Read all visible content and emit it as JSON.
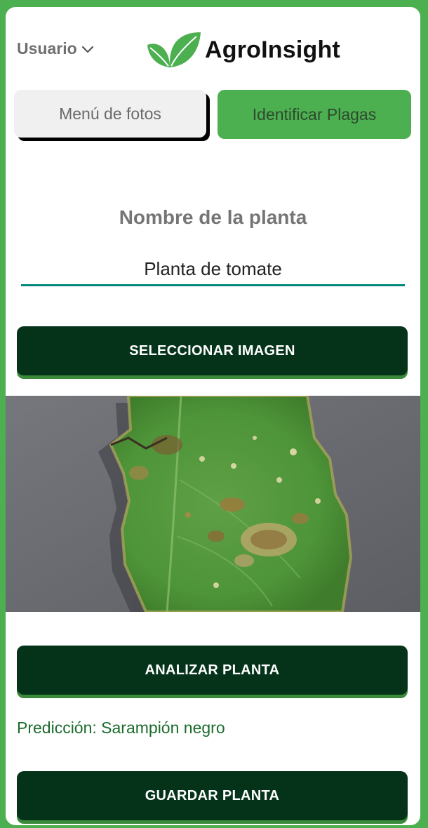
{
  "header": {
    "user_menu_label": "Usuario",
    "app_name": "AgroInsight",
    "logo_icon": "leaves-icon"
  },
  "tabs": [
    {
      "label": "Menú de fotos",
      "selected": false
    },
    {
      "label": "Identificar Plagas",
      "selected": true
    }
  ],
  "form": {
    "name_label": "Nombre de la planta",
    "name_value": "Planta de tomate"
  },
  "buttons": {
    "select_image": "SELECCIONAR IMAGEN",
    "analyze": "ANALIZAR PLANTA",
    "save": "GUARDAR PLANTA"
  },
  "result": {
    "prediction": "Predicción: Sarampión negro"
  },
  "colors": {
    "accent_green": "#4caf50",
    "button_dark": "#04331a",
    "input_underline": "#00897b",
    "prediction_text": "#1b6b2c"
  }
}
